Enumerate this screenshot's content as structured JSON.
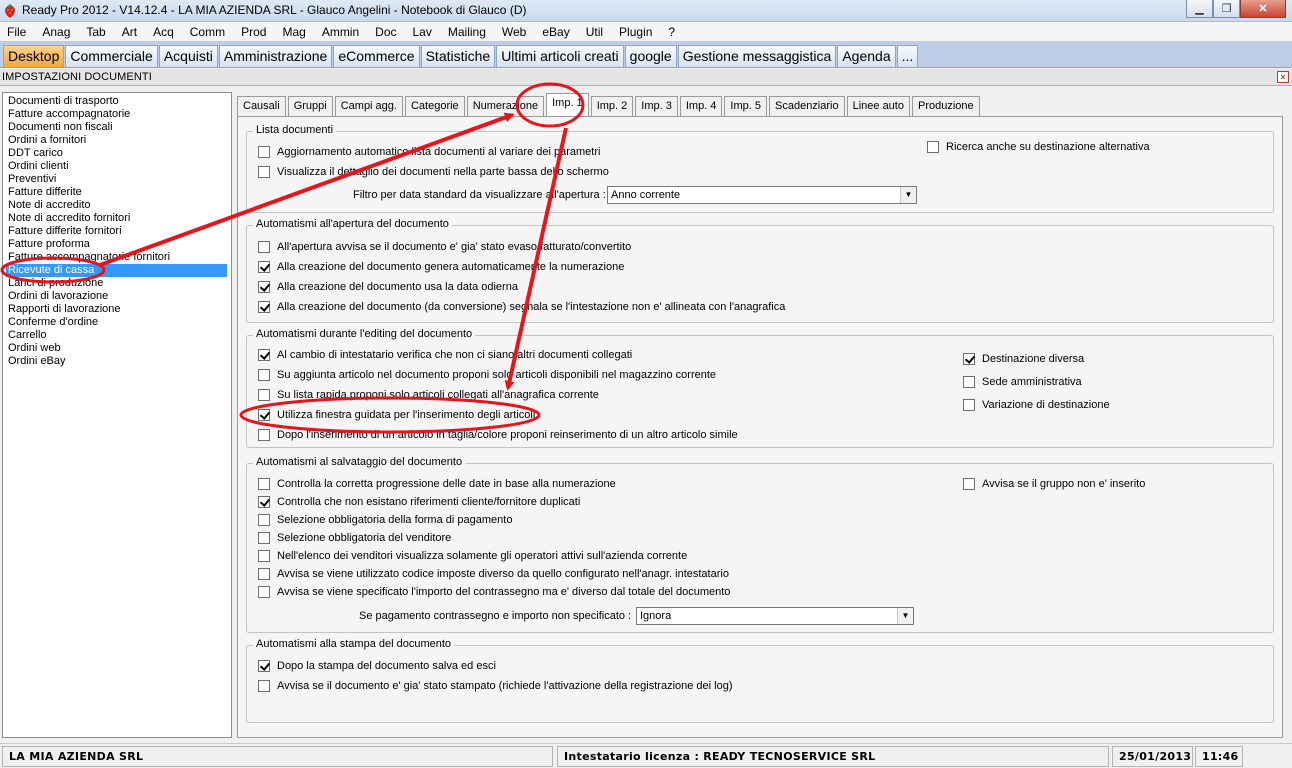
{
  "window": {
    "title": "Ready Pro 2012 - V14.12.4 - LA MIA AZIENDA SRL - Glauco Angelini - Notebook di Glauco (D)",
    "minimize": "▁",
    "maximize": "❐",
    "close": "✕"
  },
  "menu": [
    "File",
    "Anag",
    "Tab",
    "Art",
    "Acq",
    "Comm",
    "Prod",
    "Mag",
    "Ammin",
    "Doc",
    "Lav",
    "Mailing",
    "Web",
    "eBay",
    "Util",
    "Plugin",
    "?"
  ],
  "app_tabs": [
    {
      "label": "Desktop",
      "active": true
    },
    {
      "label": "Commerciale"
    },
    {
      "label": "Acquisti"
    },
    {
      "label": "Amministrazione"
    },
    {
      "label": "eCommerce"
    },
    {
      "label": "Statistiche"
    },
    {
      "label": "Ultimi articoli creati"
    },
    {
      "label": "google"
    },
    {
      "label": "Gestione messaggistica"
    },
    {
      "label": "Agenda"
    },
    {
      "label": "..."
    }
  ],
  "panel": {
    "title": "IMPOSTAZIONI DOCUMENTI",
    "close": "×"
  },
  "doc_types": [
    "Documenti di trasporto",
    "Fatture accompagnatorie",
    "Documenti non fiscali",
    "Ordini a fornitori",
    "DDT carico",
    "Ordini clienti",
    "Preventivi",
    "Fatture differite",
    "Note di accredito",
    "Note di accredito fornitori",
    "Fatture differite fornitori",
    "Fatture proforma",
    "Fatture accompagnatorie fornitori",
    "Ricevute di cassa",
    "Lanci di produzione",
    "Ordini di lavorazione",
    "Rapporti di lavorazione",
    "Conferme d'ordine",
    "Carrello",
    "Ordini web",
    "Ordini eBay"
  ],
  "selected_doc_index": 13,
  "subtabs": [
    "Causali",
    "Gruppi",
    "Campi agg.",
    "Categorie",
    "Numerazione",
    "Imp. 1",
    "Imp. 2",
    "Imp. 3",
    "Imp. 4",
    "Imp. 5",
    "Scadenziario",
    "Linee auto",
    "Produzione"
  ],
  "active_subtab_index": 5,
  "lista_documenti": {
    "title": "Lista documenti",
    "aggiornamento": {
      "label": "Aggiornamento automatico lista documenti al variare dei parametri",
      "checked": false
    },
    "visualizza_dettaglio": {
      "label": "Visualizza il dettaglio dei documenti nella parte bassa dello schermo",
      "checked": false
    },
    "ricerca_destinazione": {
      "label": "Ricerca anche su destinazione alternativa",
      "checked": false
    },
    "filtro_label": "Filtro per data standard da visualizzare all'apertura :",
    "filtro_value": "Anno corrente"
  },
  "apertura": {
    "title": "Automatismi all'apertura del documento",
    "items": [
      {
        "label": "All'apertura avvisa se il documento e' gia' stato evaso/fatturato/convertito",
        "checked": false
      },
      {
        "label": "Alla creazione del documento genera automaticamente la numerazione",
        "checked": true
      },
      {
        "label": "Alla creazione del documento usa la data odierna",
        "checked": true
      },
      {
        "label": "Alla creazione del documento (da conversione) segnala se l'intestazione non e' allineata con l'anagrafica",
        "checked": true
      }
    ]
  },
  "editing": {
    "title": "Automatismi durante l'editing del documento",
    "items": [
      {
        "label": "Al cambio di intestatario verifica che non ci siano altri documenti collegati",
        "checked": true
      },
      {
        "label": "Su aggiunta articolo nel documento proponi solo articoli disponibili nel magazzino corrente",
        "checked": false
      },
      {
        "label": "Su lista rapida proponi solo articoli collegati all'anagrafica corrente",
        "checked": false
      },
      {
        "label": "Utilizza finestra guidata per l'inserimento degli articoli",
        "checked": true
      },
      {
        "label": "Dopo l'inserimento di un articolo in taglia/colore proponi reinserimento di un altro articolo simile",
        "checked": false
      }
    ],
    "right_items": [
      {
        "label": "Destinazione diversa",
        "checked": true
      },
      {
        "label": "Sede amministrativa",
        "checked": false
      },
      {
        "label": "Variazione di destinazione",
        "checked": false
      }
    ]
  },
  "salvataggio": {
    "title": "Automatismi al salvataggio del documento",
    "items": [
      {
        "label": "Controlla la corretta progressione delle date in base alla numerazione",
        "checked": false
      },
      {
        "label": "Controlla che non esistano riferimenti cliente/fornitore duplicati",
        "checked": true
      },
      {
        "label": "Selezione obbligatoria della forma di pagamento",
        "checked": false
      },
      {
        "label": "Selezione obbligatoria del venditore",
        "checked": false
      },
      {
        "label": "Nell'elenco dei venditori visualizza solamente gli operatori attivi sull'azienda corrente",
        "checked": false
      },
      {
        "label": "Avvisa se viene utilizzato codice imposte diverso da quello configurato nell'anagr. intestatario",
        "checked": false
      },
      {
        "label": "Avvisa se viene specificato l'importo del contrassegno ma e' diverso dal totale del documento",
        "checked": false
      }
    ],
    "avvisa_gruppo": {
      "label": "Avvisa se il gruppo non e' inserito",
      "checked": false
    },
    "contrassegno_label": "Se pagamento contrassegno e importo non specificato :",
    "contrassegno_value": "Ignora"
  },
  "stampa": {
    "title": "Automatismi alla stampa del documento",
    "items": [
      {
        "label": "Dopo la stampa del documento salva ed esci",
        "checked": true
      },
      {
        "label": "Avvisa se il documento e' gia' stato stampato (richiede l'attivazione della registrazione dei log)",
        "checked": false
      }
    ]
  },
  "status": {
    "company": "LA MIA AZIENDA SRL",
    "license": "Intestatario licenza : READY TECNOSERVICE SRL",
    "date": "25/01/2013",
    "time": "11:46"
  },
  "colors": {
    "selection": "#3399ff",
    "active_tab": "#f0a83a",
    "annotation": "#e8141b"
  }
}
